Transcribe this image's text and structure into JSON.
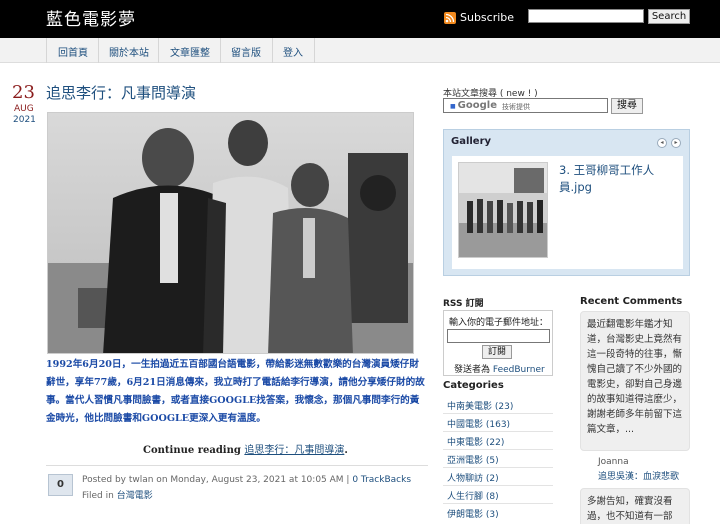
{
  "header": {
    "site_title": "藍色電影夢",
    "subscribe_label": "Subscribe",
    "search_button": "Search",
    "search_value": ""
  },
  "nav": {
    "items": [
      {
        "label": "回首頁"
      },
      {
        "label": "關於本站"
      },
      {
        "label": "文章匯整"
      },
      {
        "label": "留言版"
      },
      {
        "label": "登入"
      }
    ]
  },
  "post": {
    "date": {
      "day": "23",
      "month": "AUG",
      "year": "2021"
    },
    "title": "追思李行：凡事問導演",
    "excerpt": "1992年6月20日，一生拍過近五百部國台語電影，帶給影迷無數歡樂的台灣演員矮仔財辭世，享年77歲，6月21日消息傳來，我立時打了電話給李行導演，請他分享矮仔財的故事。當代人習慣凡事問臉書，或者直接GOOGLE找答案，我懷念，那個凡事問李行的黃金時光，他比問臉書和GOOGLE更深入更有溫度。",
    "continue_prefix": "Continue reading",
    "continue_link": "追思李行：凡事問導演",
    "comment_count": "0",
    "meta": {
      "posted_by": "Posted by twlan on Monday, August 23, 2021 at 10:05 AM |",
      "trackbacks": "0 TrackBacks",
      "filed_in": "Filed in",
      "category": "台灣電影"
    }
  },
  "sidebar": {
    "search_label": "本站文章搜尋 ( new ! )",
    "google_logo": "Google",
    "google_sub": "技術提供",
    "google_button": "搜尋",
    "gallery": {
      "title": "Gallery",
      "caption": "3. 王哥柳哥工作人員.jpg",
      "prev_icon": "◂",
      "next_icon": "▸"
    },
    "rss": {
      "heading": "RSS 訂閱",
      "prompt": "輸入你的電子郵件地址：",
      "button": "訂閱",
      "powered_prefix": "發送者為",
      "powered_link": "FeedBurner"
    },
    "categories": {
      "heading": "Categories",
      "items": [
        {
          "label": "中南美電影 (23)"
        },
        {
          "label": "中國電影 (163)"
        },
        {
          "label": "中東電影 (22)"
        },
        {
          "label": "亞洲電影 (5)"
        },
        {
          "label": "人物聊訪 (2)"
        },
        {
          "label": "人生行腳 (8)"
        },
        {
          "label": "伊朗電影 (3)"
        }
      ]
    },
    "recent_comments": {
      "heading": "Recent Comments",
      "comment1": "最近翻電影年鑑才知道，台灣影史上竟然有這一段奇特的往事，慚愧自己讀了不少外國的電影史，卻對自己身邊的故事知道得這麼少，謝謝老師多年前留下這篇文章，...",
      "author": "Joanna",
      "post_link": "追思吳漢：血淚悲歌",
      "comment2": "多謝告知，確實沒看過，也不知道有一部"
    }
  }
}
